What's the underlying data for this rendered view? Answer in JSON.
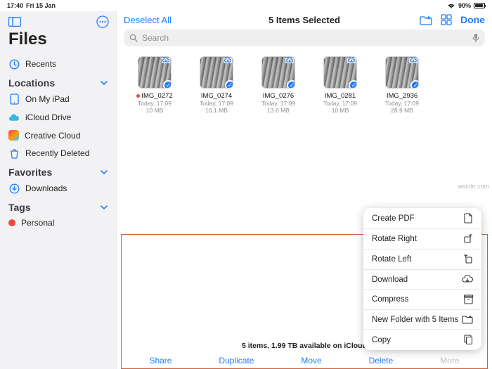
{
  "statusbar": {
    "time": "17:40",
    "date": "Fri 15 Jan",
    "battery": "90%"
  },
  "sidebar": {
    "title": "Files",
    "recents": "Recents",
    "sections": {
      "locations": "Locations",
      "favorites": "Favorites",
      "tags": "Tags"
    },
    "locations": [
      {
        "label": "On My iPad"
      },
      {
        "label": "iCloud Drive"
      },
      {
        "label": "Creative Cloud"
      },
      {
        "label": "Recently Deleted"
      }
    ],
    "favorites": [
      {
        "label": "Downloads"
      }
    ],
    "tags": [
      {
        "label": "Personal"
      }
    ]
  },
  "toolbar": {
    "deselect": "Deselect All",
    "title": "5 Items Selected",
    "done": "Done"
  },
  "search": {
    "placeholder": "Search"
  },
  "files": [
    {
      "name": "IMG_0272",
      "time": "Today, 17:09",
      "size": "10 MB",
      "tagged": true
    },
    {
      "name": "IMG_0274",
      "time": "Today, 17:09",
      "size": "10.1 MB",
      "tagged": false
    },
    {
      "name": "IMG_0276",
      "time": "Today, 17:09",
      "size": "13.6 MB",
      "tagged": false
    },
    {
      "name": "IMG_0281",
      "time": "Today, 17:09",
      "size": "10 MB",
      "tagged": false
    },
    {
      "name": "IMG_2936",
      "time": "Today, 17:09",
      "size": "28.9 MB",
      "tagged": false
    }
  ],
  "status_line": "5 items, 1.99 TB available on iCloud",
  "bottom_actions": {
    "share": "Share",
    "duplicate": "Duplicate",
    "move": "Move",
    "delete": "Delete",
    "more": "More"
  },
  "popover": [
    {
      "label": "Create PDF",
      "icon": "document-icon"
    },
    {
      "label": "Rotate Right",
      "icon": "rotate-right-icon"
    },
    {
      "label": "Rotate Left",
      "icon": "rotate-left-icon"
    },
    {
      "label": "Download",
      "icon": "download-cloud-icon"
    },
    {
      "label": "Compress",
      "icon": "archive-icon"
    },
    {
      "label": "New Folder with 5 Items",
      "icon": "new-folder-icon"
    },
    {
      "label": "Copy",
      "icon": "copy-icon"
    }
  ],
  "watermark": "wsxdn.com"
}
